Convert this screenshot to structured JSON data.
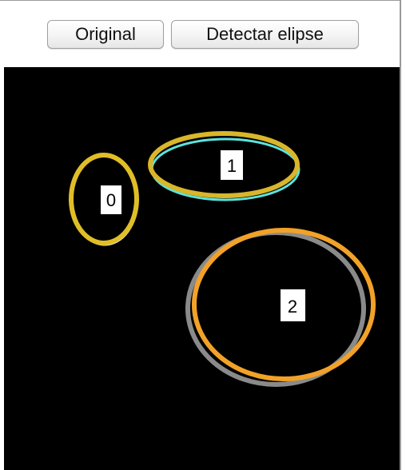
{
  "toolbar": {
    "original_label": "Original",
    "detect_label": "Detectar elipse"
  },
  "canvas": {
    "background": "#000000",
    "ellipses": [
      {
        "label": "0",
        "color": "#e0be27",
        "shadow_color": "#ffffff"
      },
      {
        "label": "1",
        "color": "#d9b62a",
        "shadow_color": "#5de3de"
      },
      {
        "label": "2",
        "color": "#f2a228",
        "shadow_color": "#8a8a8a"
      }
    ]
  }
}
